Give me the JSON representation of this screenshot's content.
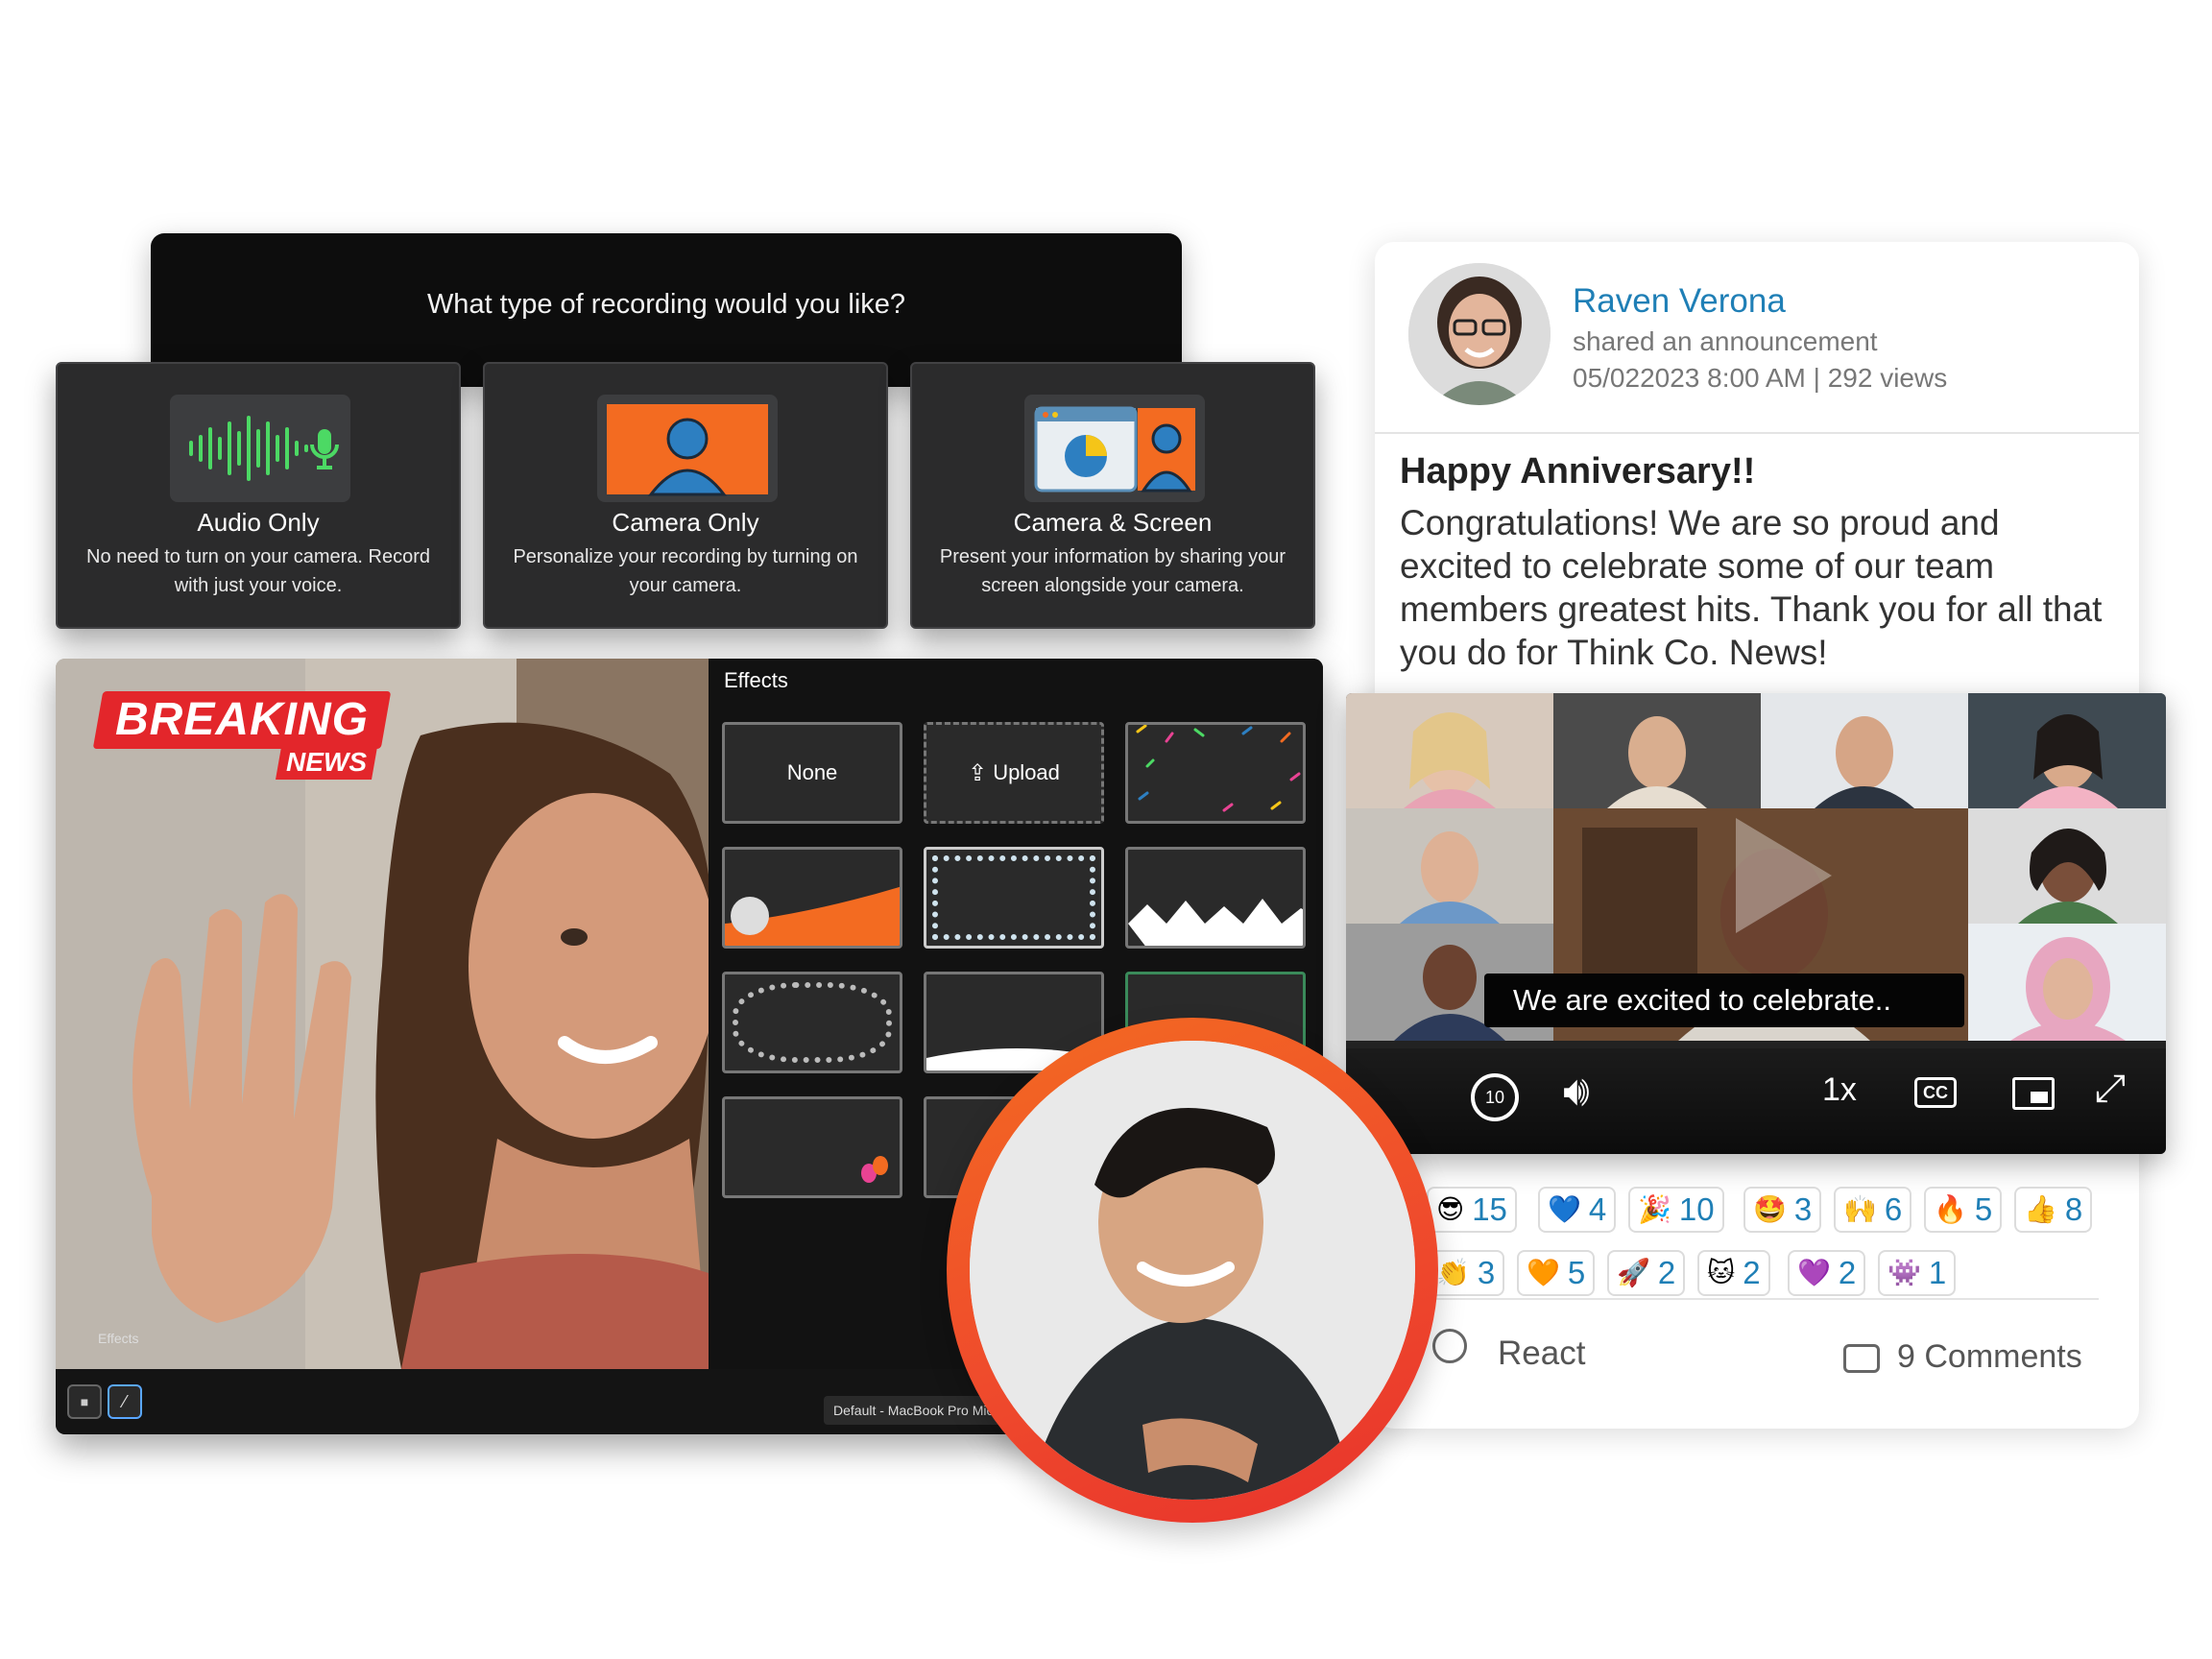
{
  "recording": {
    "question": "What type of recording would you like?",
    "options": [
      {
        "title": "Audio Only",
        "desc": "No need to turn on your camera. Record with just your voice."
      },
      {
        "title": "Camera Only",
        "desc": "Personalize your recording by turning on your camera."
      },
      {
        "title": "Camera & Screen",
        "desc": "Present your information by sharing your screen alongside your camera."
      }
    ]
  },
  "video_editor": {
    "badge_top": "BREAKING",
    "badge_bottom": "NEWS",
    "effects_title": "Effects",
    "tile_none": "None",
    "tile_upload": "Upload",
    "effects_tooltip": "Effects",
    "mic_device": "Default - MacBook Pro Microphone"
  },
  "post": {
    "author": "Raven Verona",
    "action": "shared an announcement",
    "date": "05/022023 8:00 AM",
    "views": "292 views",
    "title": "Happy Anniversary!!",
    "body": "Congratulations! We are so proud and excited to celebrate some of our team members greatest hits. Thank you for all that you do for Think Co. News!"
  },
  "player": {
    "caption": "We are excited to celebrate..",
    "speed": "1x",
    "cc": "CC",
    "rewind_seconds": "10"
  },
  "reactions": {
    "row1": [
      {
        "emoji": "😎",
        "count": "15"
      },
      {
        "emoji": "💙",
        "count": "4"
      },
      {
        "emoji": "🎉",
        "count": "10"
      },
      {
        "emoji": "🤩",
        "count": "3"
      },
      {
        "emoji": "🙌",
        "count": "6"
      },
      {
        "emoji": "🔥",
        "count": "5"
      },
      {
        "emoji": "👍",
        "count": "8"
      }
    ],
    "row2": [
      {
        "emoji": "👏",
        "count": "3"
      },
      {
        "emoji": "🧡",
        "count": "5"
      },
      {
        "emoji": "🚀",
        "count": "2"
      },
      {
        "emoji": "🐱",
        "count": "2"
      },
      {
        "emoji": "💜",
        "count": "2"
      },
      {
        "emoji": "👾",
        "count": "1"
      }
    ],
    "react_label": "React",
    "comments_label": "9 Comments"
  },
  "colors": {
    "accent_blue": "#1f7fb6",
    "brand_orange": "#f36b21",
    "breaking_red": "#e3262b",
    "audio_green": "#4cd964"
  }
}
